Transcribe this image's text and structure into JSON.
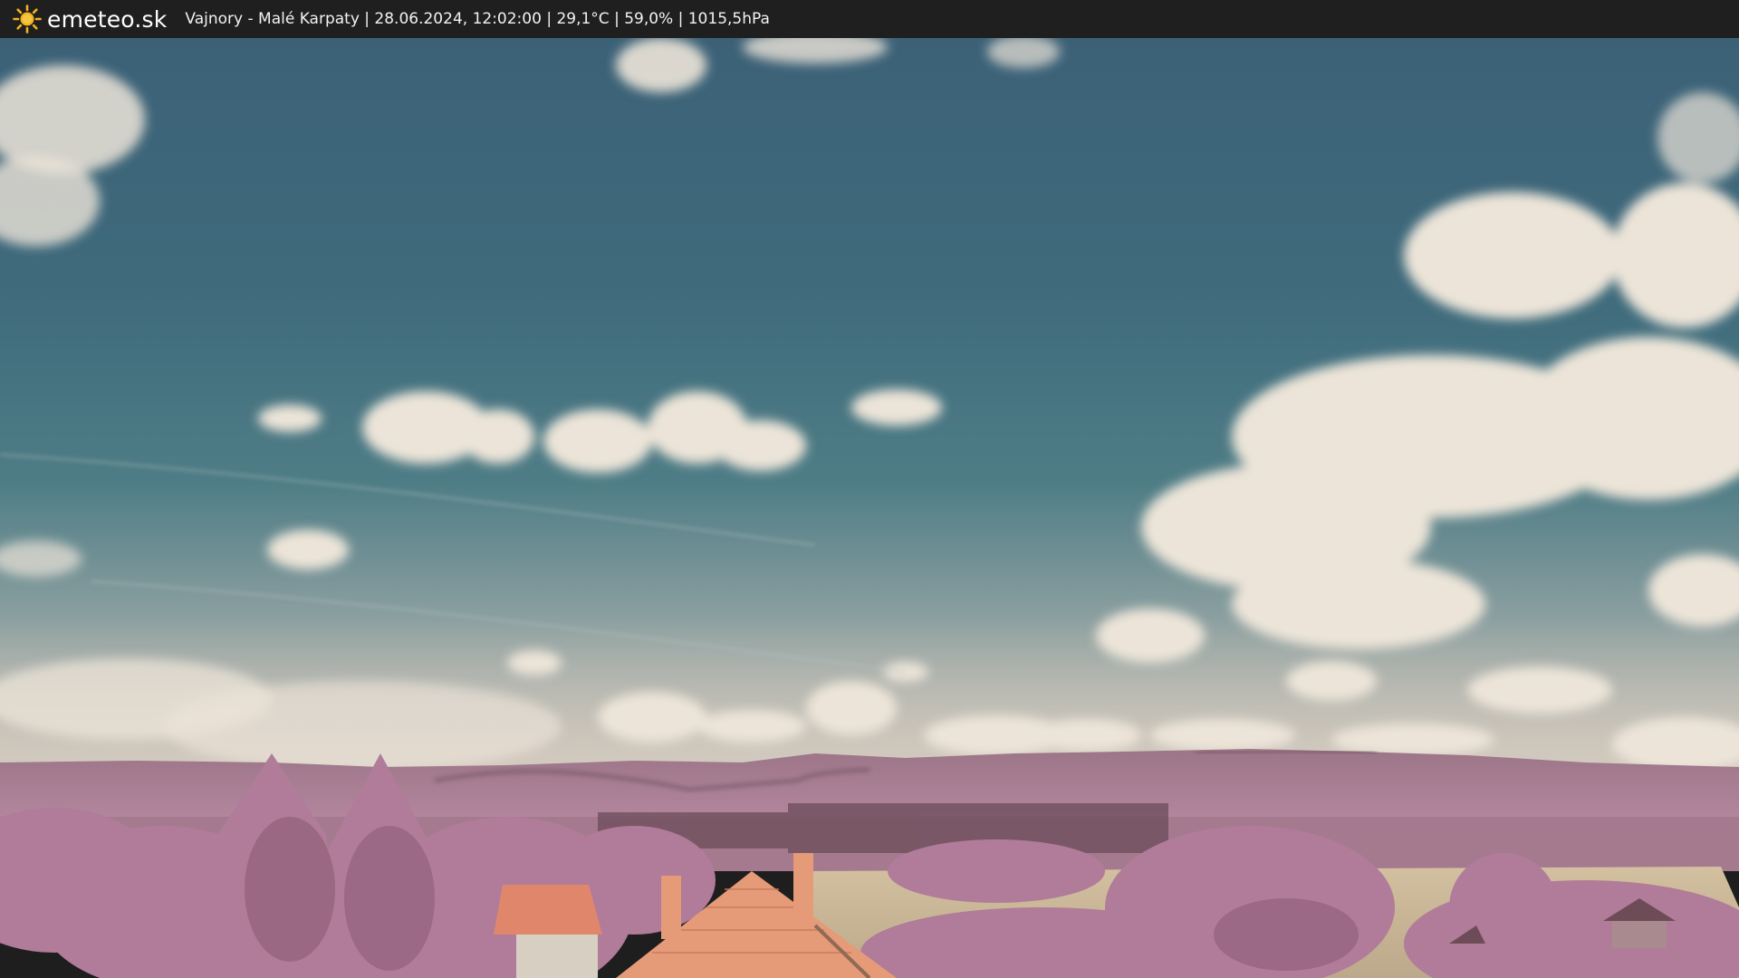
{
  "header": {
    "logo_icon": "sun-icon",
    "brand": "emeteo.sk",
    "caption": "Vajnory - Malé Karpaty | 28.06.2024, 12:02:00 | 29,1°C | 59,0% | 1015,5hPa"
  },
  "colors": {
    "header_bg": "#1f1f1f",
    "sun": "#f2b320",
    "sky_top": "#3d6478",
    "sky_bottom": "#8fa2a4",
    "cloud": "#ede6d9",
    "vegetation": "#b37f9c",
    "roof": "#e59a78",
    "field": "#cbb797"
  }
}
